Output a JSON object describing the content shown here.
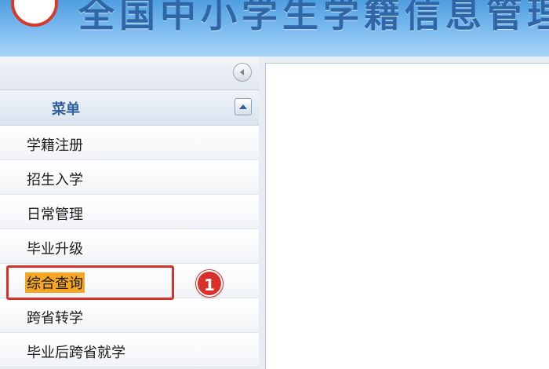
{
  "header": {
    "title": "全国中小学生学籍信息管理",
    "logo_icon": "school-logo-icon"
  },
  "sidebar": {
    "collapse_icon": "collapse-left-icon",
    "menu_title": "菜单",
    "menu_toggle_icon": "chevron-up-icon",
    "items": [
      {
        "label": "学籍注册"
      },
      {
        "label": "招生入学"
      },
      {
        "label": "日常管理"
      },
      {
        "label": "毕业升级"
      },
      {
        "label": "综合查询",
        "highlighted": true
      },
      {
        "label": "跨省转学"
      },
      {
        "label": "毕业后跨省就学"
      }
    ]
  },
  "annotation": {
    "step_number": "1",
    "color": "#d9302a"
  },
  "colors": {
    "header_blue": "#4e9ee0",
    "highlight": "#f5a623",
    "menu_title": "#2f5f9c"
  }
}
